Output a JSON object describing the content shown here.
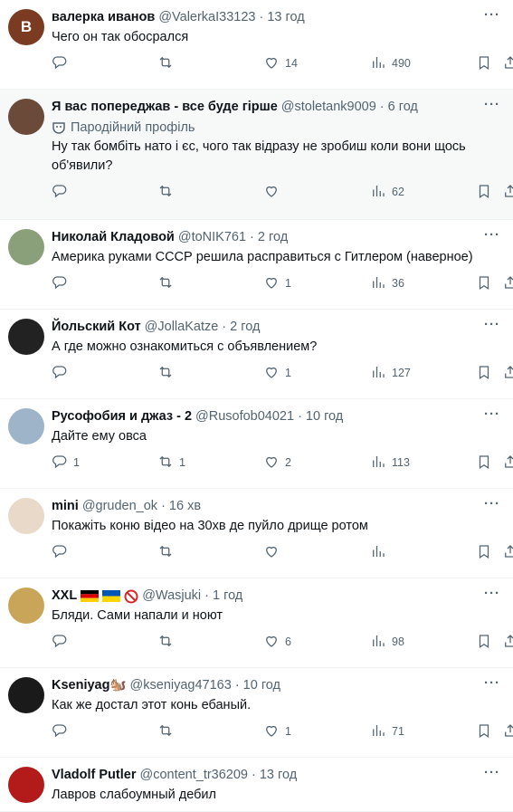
{
  "tweets": [
    {
      "avatar_letter": "В",
      "avatar_color": "#7a3b22",
      "name": "валерка иванов",
      "handle": "@ValerkaI33123",
      "time": "13 год",
      "text": "Чего он так обосрался",
      "replies": "",
      "retweets": "",
      "likes": "14",
      "views": "490",
      "shaded": false
    },
    {
      "avatar_letter": "",
      "avatar_color": "#6b4a3a",
      "name": "Я вас попереджав - все буде гірше",
      "handle": "@stoletank9009",
      "time": "6 год",
      "parody": "Пародійний профіль",
      "text": "Ну так бомбіть нато і єс, чого так відразу не зробиш коли вони щось об'явили?",
      "replies": "",
      "retweets": "",
      "likes": "",
      "views": "62",
      "shaded": true
    },
    {
      "avatar_letter": "",
      "avatar_color": "#8aa07a",
      "name": "Николай Кладовой",
      "handle": "@toNIK761",
      "time": "2 год",
      "text": "Америка руками СССР решила расправиться с Гитлером (наверное)",
      "replies": "",
      "retweets": "",
      "likes": "1",
      "views": "36",
      "shaded": false
    },
    {
      "avatar_letter": "",
      "avatar_color": "#222222",
      "name": "Йольский Кот",
      "handle": "@JollaKatze",
      "time": "2 год",
      "text": "А где можно ознакомиться с объявлением?",
      "replies": "",
      "retweets": "",
      "likes": "1",
      "views": "127",
      "shaded": false
    },
    {
      "avatar_letter": "",
      "avatar_color": "#9db4c9",
      "name": "Русофобия и джаз - 2",
      "handle": "@Rusofob04021",
      "time": "10 год",
      "text": "Дайте ему овса",
      "replies": "1",
      "retweets": "1",
      "likes": "2",
      "views": "113",
      "shaded": false
    },
    {
      "avatar_letter": "",
      "avatar_color": "#e8d9c9",
      "name": "mini",
      "handle": "@gruden_ok",
      "time": "16 хв",
      "text": "Покажіть коню відео на 30хв де пуйло дрище ротом",
      "replies": "",
      "retweets": "",
      "likes": "",
      "views": "",
      "shaded": false
    },
    {
      "avatar_letter": "",
      "avatar_color": "#c9a55a",
      "name": "XXL",
      "handle": "@Wasjuki",
      "time": "1 год",
      "text": "Бляди. Сами напали и ноют",
      "replies": "",
      "retweets": "",
      "likes": "6",
      "views": "98",
      "shaded": false,
      "flags": true
    },
    {
      "avatar_letter": "",
      "avatar_color": "#1a1a1a",
      "name": "Kseniyag🐿️",
      "handle": "@kseniyag47163",
      "time": "10 год",
      "text": "Как же достал этот конь ебаный.",
      "replies": "",
      "retweets": "",
      "likes": "1",
      "views": "71",
      "shaded": false
    },
    {
      "avatar_letter": "",
      "avatar_color": "#b31b1b",
      "name": "Vladolf Putler",
      "handle": "@content_tr36209",
      "time": "13 год",
      "text": "Лавров слабоумный дебил",
      "replies": "",
      "retweets": "",
      "likes": "",
      "views": "",
      "shaded": false,
      "partial": true
    }
  ]
}
